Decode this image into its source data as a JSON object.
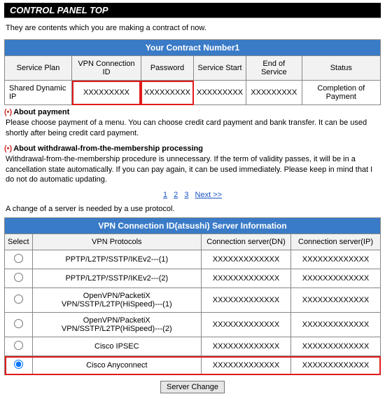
{
  "title": "CONTROL PANEL TOP",
  "intro": "They are contents which you are making a contract of now.",
  "contract": {
    "header": "Your Contract Number1",
    "cols": {
      "plan": "Service Plan",
      "vpnid": "VPN Connection ID",
      "pass": "Password",
      "start": "Service Start",
      "end": "End of Service",
      "status": "Status"
    },
    "row": {
      "plan": "Shared Dynamic IP",
      "vpnid": "XXXXXXXXX",
      "pass": "XXXXXXXXX",
      "start": "XXXXXXXXX",
      "end": "XXXXXXXXX",
      "status": "Completion of Payment"
    }
  },
  "notes": {
    "payment_title": "About payment",
    "payment_body": "Please choose payment of a menu. You can choose credit card payment and bank transfer. It can be used shortly after being credit card payment.",
    "withdraw_title": "About withdrawal-from-the-membership processing",
    "withdraw_body": "Withdrawal-from-the-membership procedure is unnecessary. If the term of validity passes, it will be in a cancellation state automatically. If you can pay again, it can be used immediately. Please keep in mind that I do not do automatic updating."
  },
  "pager": {
    "p1": "1",
    "p2": "2",
    "p3": "3",
    "next": "Next >>"
  },
  "server_note": "A change of a server is needed by a use protocol.",
  "server": {
    "header": "VPN Connection ID(atsushi) Server Information",
    "cols": {
      "select": "Select",
      "proto": "VPN Protocols",
      "dn": "Connection server(DN)",
      "ip": "Connection server(IP)"
    },
    "rows": [
      {
        "proto": "PPTP/L2TP/SSTP/IKEv2---(1)",
        "dn": "XXXXXXXXXXXXX",
        "ip": "XXXXXXXXXXXXX",
        "selected": false
      },
      {
        "proto": "PPTP/L2TP/SSTP/IKEv2---(2)",
        "dn": "XXXXXXXXXXXXX",
        "ip": "XXXXXXXXXXXXX",
        "selected": false
      },
      {
        "proto": "OpenVPN/PacketiX VPN/SSTP/L2TP(HiSpeed)---(1)",
        "dn": "XXXXXXXXXXXXX",
        "ip": "XXXXXXXXXXXXX",
        "selected": false
      },
      {
        "proto": "OpenVPN/PacketiX VPN/SSTP/L2TP(HiSpeed)---(2)",
        "dn": "XXXXXXXXXXXXX",
        "ip": "XXXXXXXXXXXXX",
        "selected": false
      },
      {
        "proto": "Cisco IPSEC",
        "dn": "XXXXXXXXXXXXX",
        "ip": "XXXXXXXXXXXXX",
        "selected": false
      },
      {
        "proto": "Cisco Anyconnect",
        "dn": "XXXXXXXXXXXXX",
        "ip": "XXXXXXXXXXXXX",
        "selected": true
      }
    ]
  },
  "button": "Server Change"
}
